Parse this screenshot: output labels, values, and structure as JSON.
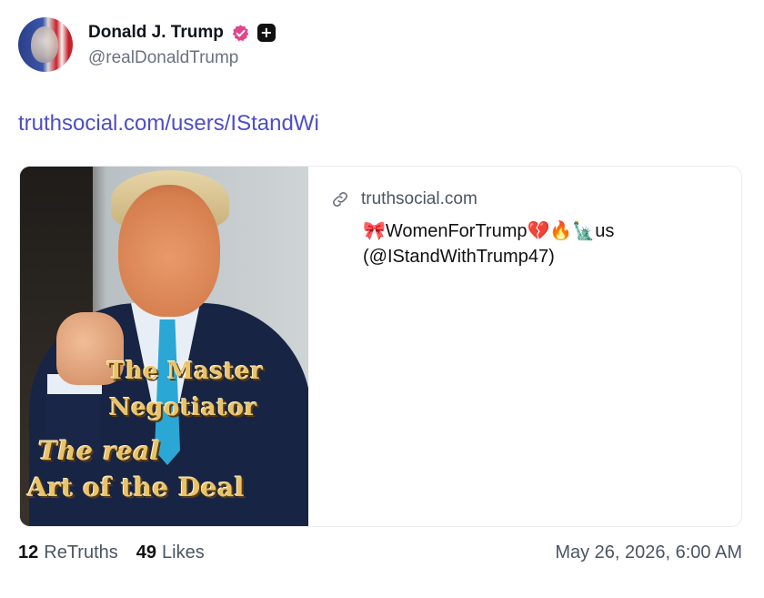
{
  "author": {
    "display_name": "Donald J. Trump",
    "handle": "@realDonaldTrump",
    "verified_icon": "verified-badge-icon",
    "plus_icon": "plus-badge-icon",
    "plus_glyph": "+"
  },
  "post": {
    "link_text": "truthsocial.com/users/IStandWi"
  },
  "card": {
    "domain": "truthsocial.com",
    "title": "🎀WomenForTrump💔🔥🗽us (@IStandWithTrump47)",
    "image_text": {
      "line1": "The Master",
      "line2": "Negotiator",
      "line3": "The real",
      "line4": "Art of the Deal"
    }
  },
  "footer": {
    "retruths_count": "12",
    "retruths_label": "ReTruths",
    "likes_count": "49",
    "likes_label": "Likes",
    "timestamp": "May 26, 2026, 6:00 AM"
  },
  "colors": {
    "link": "#4c4ec9",
    "verified": "#e1458a",
    "muted": "#6b7280"
  }
}
